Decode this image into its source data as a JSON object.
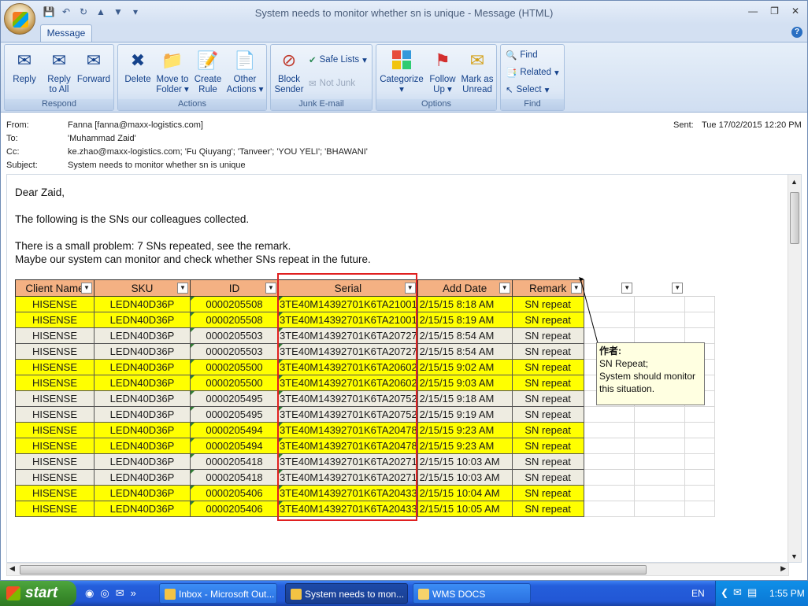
{
  "window": {
    "title": "System needs to monitor whether sn is unique - Message (HTML)"
  },
  "tabs": {
    "message": "Message"
  },
  "ribbon": {
    "respond": {
      "title": "Respond",
      "reply": "Reply",
      "reply_all_1": "Reply",
      "reply_all_2": "to All",
      "forward": "Forward"
    },
    "actions": {
      "title": "Actions",
      "delete": "Delete",
      "move_1": "Move to",
      "move_2": "Folder",
      "rule_1": "Create",
      "rule_2": "Rule",
      "other_1": "Other",
      "other_2": "Actions"
    },
    "junk": {
      "title": "Junk E-mail",
      "block_1": "Block",
      "block_2": "Sender",
      "safe_lists": "Safe Lists",
      "not_junk": "Not Junk"
    },
    "options": {
      "title": "Options",
      "categorize": "Categorize",
      "follow_1": "Follow",
      "follow_2": "Up",
      "mark_1": "Mark as",
      "mark_2": "Unread"
    },
    "find": {
      "title": "Find",
      "find": "Find",
      "related": "Related",
      "select": "Select"
    }
  },
  "header": {
    "from_label": "From:",
    "from": "Fanna [fanna@maxx-logistics.com]",
    "to_label": "To:",
    "to": "'Muhammad Zaid'",
    "cc_label": "Cc:",
    "cc": "ke.zhao@maxx-logistics.com; 'Fu Qiuyang'; 'Tanveer'; 'YOU YELI'; 'BHAWANI'",
    "subject_label": "Subject:",
    "subject": "System needs to monitor whether sn is unique",
    "sent_label": "Sent:",
    "sent": "Tue 17/02/2015 12:20 PM"
  },
  "body": {
    "greeting": "Dear Zaid,",
    "line1": "The following is the SNs our colleagues collected.",
    "line2": "There is a small problem: 7 SNs repeated, see the remark.",
    "line3": "Maybe our system can monitor and check whether SNs repeat in the future."
  },
  "table": {
    "headers": [
      "Client Name",
      "SKU",
      "ID",
      "Serial",
      "Add Date",
      "Remark"
    ],
    "rows": [
      {
        "hl": "y",
        "cells": [
          "HISENSE",
          "LEDN40D36P",
          "0000205508",
          "3TE40M14392701K6TA21001",
          "2/15/15 8:18 AM",
          "SN repeat"
        ]
      },
      {
        "hl": "y",
        "cells": [
          "HISENSE",
          "LEDN40D36P",
          "0000205508",
          "3TE40M14392701K6TA21001",
          "2/15/15 8:19 AM",
          "SN repeat"
        ]
      },
      {
        "hl": "g",
        "cells": [
          "HISENSE",
          "LEDN40D36P",
          "0000205503",
          "3TE40M14392701K6TA20727",
          "2/15/15 8:54 AM",
          "SN repeat"
        ]
      },
      {
        "hl": "g",
        "cells": [
          "HISENSE",
          "LEDN40D36P",
          "0000205503",
          "3TE40M14392701K6TA20727",
          "2/15/15 8:54 AM",
          "SN repeat"
        ]
      },
      {
        "hl": "y",
        "cells": [
          "HISENSE",
          "LEDN40D36P",
          "0000205500",
          "3TE40M14392701K6TA20602",
          "2/15/15 9:02 AM",
          "SN repeat"
        ]
      },
      {
        "hl": "y",
        "cells": [
          "HISENSE",
          "LEDN40D36P",
          "0000205500",
          "3TE40M14392701K6TA20602",
          "2/15/15 9:03 AM",
          "SN repeat"
        ]
      },
      {
        "hl": "g",
        "cells": [
          "HISENSE",
          "LEDN40D36P",
          "0000205495",
          "3TE40M14392701K6TA20752",
          "2/15/15 9:18 AM",
          "SN repeat"
        ]
      },
      {
        "hl": "g",
        "cells": [
          "HISENSE",
          "LEDN40D36P",
          "0000205495",
          "3TE40M14392701K6TA20752",
          "2/15/15 9:19 AM",
          "SN repeat"
        ]
      },
      {
        "hl": "y",
        "cells": [
          "HISENSE",
          "LEDN40D36P",
          "0000205494",
          "3TE40M14392701K6TA20478",
          "2/15/15 9:23 AM",
          "SN repeat"
        ]
      },
      {
        "hl": "y",
        "cells": [
          "HISENSE",
          "LEDN40D36P",
          "0000205494",
          "3TE40M14392701K6TA20478",
          "2/15/15 9:23 AM",
          "SN repeat"
        ]
      },
      {
        "hl": "g",
        "cells": [
          "HISENSE",
          "LEDN40D36P",
          "0000205418",
          "3TE40M14392701K6TA20271",
          "2/15/15 10:03 AM",
          "SN repeat"
        ]
      },
      {
        "hl": "g",
        "cells": [
          "HISENSE",
          "LEDN40D36P",
          "0000205418",
          "3TE40M14392701K6TA20271",
          "2/15/15 10:03 AM",
          "SN repeat"
        ]
      },
      {
        "hl": "y",
        "cells": [
          "HISENSE",
          "LEDN40D36P",
          "0000205406",
          "3TE40M14392701K6TA20433",
          "2/15/15 10:04 AM",
          "SN repeat"
        ]
      },
      {
        "hl": "y",
        "cells": [
          "HISENSE",
          "LEDN40D36P",
          "0000205406",
          "3TE40M14392701K6TA20433",
          "2/15/15 10:05 AM",
          "SN repeat"
        ]
      }
    ],
    "colors": {
      "header": "#f4b183",
      "yellow": "#ffff00",
      "grey": "#eeece1",
      "highlight_box": "#e02020"
    }
  },
  "comment": {
    "author": "作者:",
    "line1": "SN Repeat;",
    "line2": "System should monitor",
    "line3": "this situation."
  },
  "taskbar": {
    "start": "start",
    "items": [
      "Inbox - Microsoft Out...",
      "System needs to mon...",
      "WMS DOCS"
    ],
    "lang": "EN",
    "clock": "1:55 PM"
  }
}
